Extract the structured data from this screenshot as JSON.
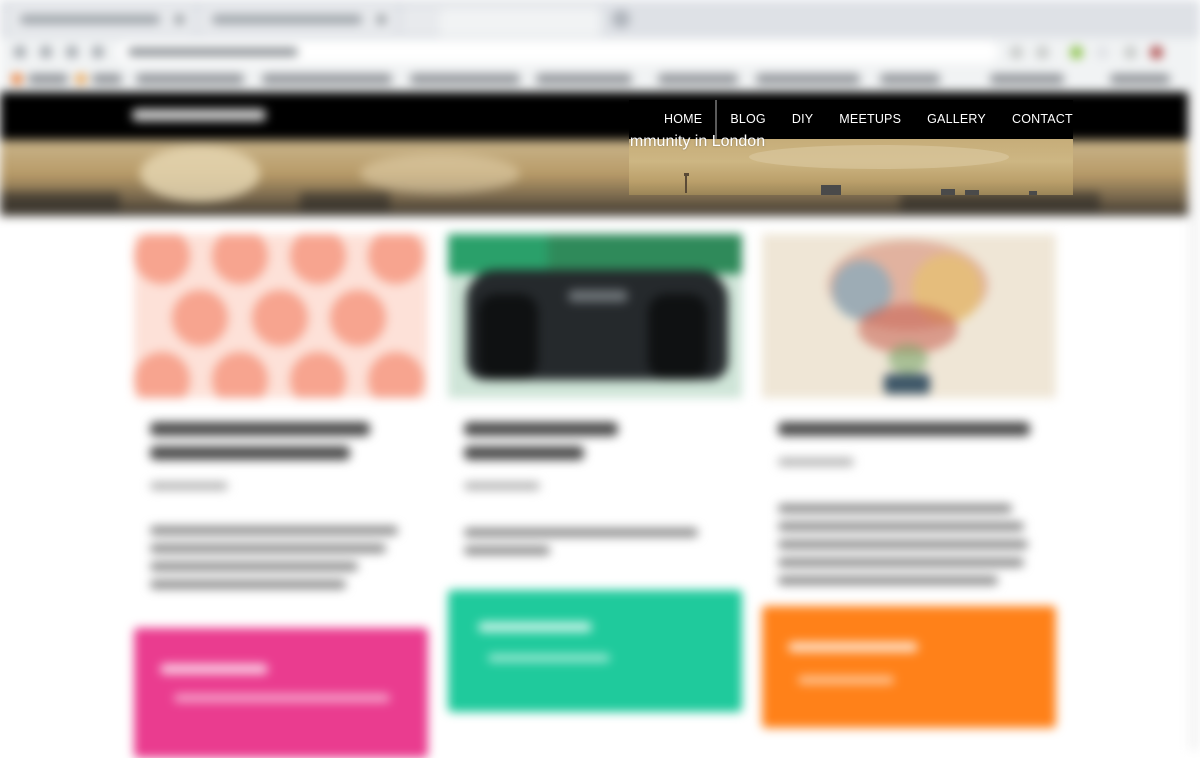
{
  "navigation": {
    "items": [
      {
        "label": "HOME",
        "active": true
      },
      {
        "label": "BLOG",
        "active": false
      },
      {
        "label": "DIY",
        "active": false
      },
      {
        "label": "MEETUPS",
        "active": false
      },
      {
        "label": "GALLERY",
        "active": false
      },
      {
        "label": "CONTACT",
        "active": false
      }
    ]
  },
  "hero": {
    "tagline_fragment": "ommunity in London"
  },
  "cards": {
    "accent_colors": [
      "#ea3c8f",
      "#1fca9c",
      "#ff8119"
    ]
  },
  "colors": {
    "nav_background": "#000000",
    "nav_text": "#ffffff"
  }
}
